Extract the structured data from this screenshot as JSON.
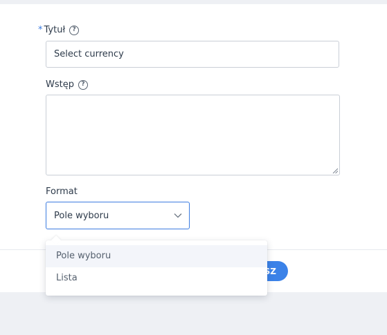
{
  "form": {
    "title_field": {
      "required_marker": "*",
      "label": "Tytuł",
      "value": "Select currency"
    },
    "intro_field": {
      "label": "Wstęp",
      "value": ""
    },
    "format_field": {
      "label": "Format",
      "selected": "Pole wyboru"
    }
  },
  "dropdown": {
    "options": [
      "Pole wyboru",
      "Lista"
    ],
    "highlighted_index": 0
  },
  "footer": {
    "primary_button_label_visible": "sz"
  },
  "colors": {
    "accent": "#3b7be0",
    "border": "#c9ced6",
    "page_bg": "#eef0f4"
  },
  "icons": {
    "help": "question-circle-icon",
    "chevron": "chevron-down-icon"
  }
}
